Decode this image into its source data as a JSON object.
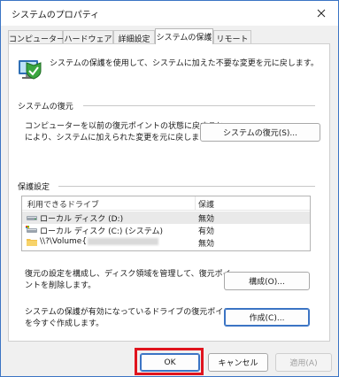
{
  "window": {
    "title": "システムのプロパティ"
  },
  "tabs": [
    {
      "label": "コンピューター名"
    },
    {
      "label": "ハードウェア"
    },
    {
      "label": "詳細設定"
    },
    {
      "label": "システムの保護"
    },
    {
      "label": "リモート"
    }
  ],
  "intro": {
    "text": "システムの保護を使用して、システムに加えた不要な変更を元に戻します。"
  },
  "restore": {
    "section_title": "システムの復元",
    "desc_line1": "コンピューターを以前の復元ポイントの状態に戻すこと",
    "desc_line2": "により、システムに加えられた変更を元に戻します。",
    "button_label": "システムの復元(S)..."
  },
  "protection": {
    "section_title": "保護設定",
    "columns": {
      "drive": "利用できるドライブ",
      "status": "保護"
    },
    "drives": [
      {
        "name": "ローカル ディスク (D:)",
        "status": "無効",
        "icon": "drive-icon"
      },
      {
        "name": "ローカル ディスク (C:) (システム)",
        "status": "有効",
        "icon": "system-drive-icon"
      },
      {
        "name": "\\\\?\\Volume{",
        "status": "無効",
        "icon": "folder-icon"
      }
    ],
    "configure_desc_line1": "復元の設定を構成し、ディスク領域を管理して、復元ポイ",
    "configure_desc_line2": "ントを削除します。",
    "configure_button": "構成(O)...",
    "create_desc_line1": "システムの保護が有効になっているドライブの復元ポイント",
    "create_desc_line2": "を今すぐ作成します。",
    "create_button": "作成(C)..."
  },
  "footer": {
    "ok": "OK",
    "cancel": "キャンセル",
    "apply": "適用(A)"
  },
  "colors": {
    "highlight": "#e0141e",
    "focus": "#3b74c4"
  }
}
